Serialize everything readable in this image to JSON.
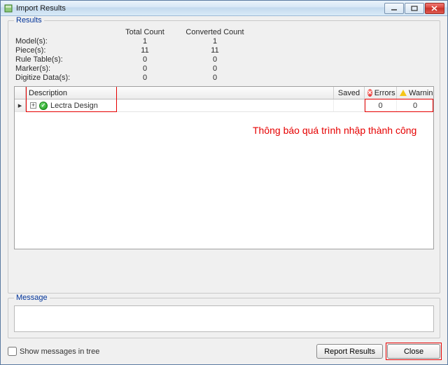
{
  "window": {
    "title": "Import Results"
  },
  "results": {
    "label": "Results",
    "headers": {
      "total": "Total Count",
      "converted": "Converted Count"
    },
    "rows": [
      {
        "label": "Model(s):",
        "total": "1",
        "converted": "1"
      },
      {
        "label": "Piece(s):",
        "total": "11",
        "converted": "11"
      },
      {
        "label": "Rule Table(s):",
        "total": "0",
        "converted": "0"
      },
      {
        "label": "Marker(s):",
        "total": "0",
        "converted": "0"
      },
      {
        "label": "Digitize Data(s):",
        "total": "0",
        "converted": "0"
      }
    ]
  },
  "grid": {
    "columns": {
      "description": "Description",
      "saved": "Saved",
      "errors": "Errors",
      "warnings": "Warnin"
    },
    "row_indicator": "▸",
    "expander_glyph": "+",
    "ok_glyph": "✓",
    "err_glyph": "✕",
    "rows": [
      {
        "description": "Lectra Design",
        "saved": "",
        "errors": "0",
        "warnings": "0"
      }
    ]
  },
  "annotation": {
    "text": "Thông báo quá trình nhập thành công"
  },
  "message": {
    "label": "Message"
  },
  "footer": {
    "checkbox_label": "Show messages in tree",
    "report_button": "Report Results",
    "close_button": "Close"
  }
}
